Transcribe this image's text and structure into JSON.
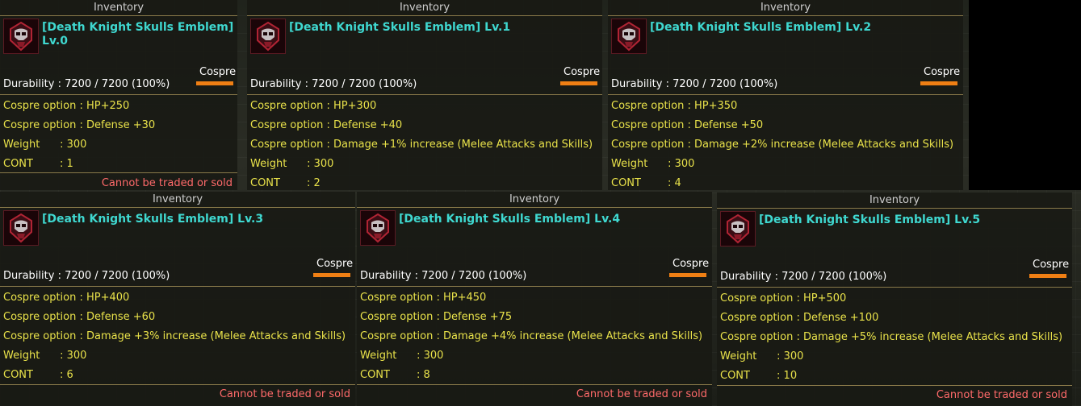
{
  "header_title": "Inventory",
  "cospre_label": "Cospre",
  "untradeable_text": "Cannot be traded or sold",
  "colors": {
    "item_name": "#3fd8d0",
    "option_text": "#e9e24a",
    "untradeable": "#ff6a6a",
    "cospre_bar": "#ef7f14"
  },
  "icon": "death-knight-skull-emblem-icon",
  "tooltips": [
    {
      "name": "[Death Knight Skulls Emblem]\nLv.0",
      "durability": "Durability : 7200 / 7200 (100%)",
      "options": [
        "Cospre option : HP+250",
        "Cospre option : Defense +30"
      ],
      "weight": "Weight      : 300",
      "cont": "CONT        : 1"
    },
    {
      "name": "[Death Knight Skulls Emblem] Lv.1",
      "durability": "Durability : 7200 / 7200 (100%)",
      "options": [
        "Cospre option : HP+300",
        "Cospre option : Defense +40",
        "Cospre option : Damage +1% increase (Melee Attacks and Skills)"
      ],
      "weight": "Weight      : 300",
      "cont": "CONT        : 2"
    },
    {
      "name": "[Death Knight Skulls Emblem] Lv.2",
      "durability": "Durability : 7200 / 7200 (100%)",
      "options": [
        "Cospre option : HP+350",
        "Cospre option : Defense +50",
        "Cospre option : Damage +2% increase (Melee Attacks and Skills)"
      ],
      "weight": "Weight      : 300",
      "cont": "CONT        : 4"
    },
    {
      "name": "[Death Knight Skulls Emblem] Lv.3",
      "durability": "Durability : 7200 / 7200 (100%)",
      "options": [
        "Cospre option : HP+400",
        "Cospre option : Defense +60",
        "Cospre option : Damage +3% increase (Melee Attacks and Skills)"
      ],
      "weight": "Weight      : 300",
      "cont": "CONT        : 6"
    },
    {
      "name": "[Death Knight Skulls Emblem] Lv.4",
      "durability": "Durability : 7200 / 7200 (100%)",
      "options": [
        "Cospre option : HP+450",
        "Cospre option : Defense +75",
        "Cospre option : Damage +4% increase (Melee Attacks and Skills)"
      ],
      "weight": "Weight      : 300",
      "cont": "CONT        : 8"
    },
    {
      "name": "[Death Knight Skulls Emblem] Lv.5",
      "durability": "Durability : 7200 / 7200 (100%)",
      "options": [
        "Cospre option : HP+500",
        "Cospre option : Defense +100",
        "Cospre option : Damage +5% increase (Melee Attacks and Skills)"
      ],
      "weight": "Weight      : 300",
      "cont": "CONT        : 10"
    }
  ]
}
